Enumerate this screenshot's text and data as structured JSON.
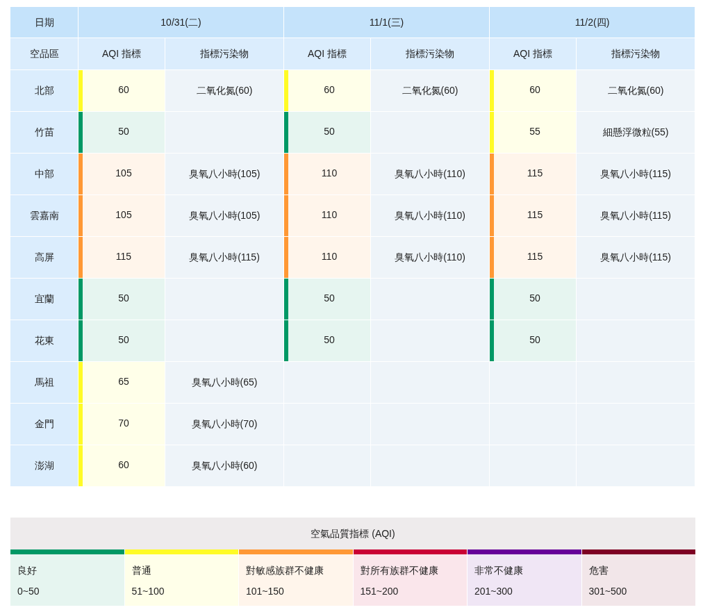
{
  "table": {
    "date_heading": "日期",
    "region_heading": "空品區",
    "dates": [
      {
        "date": "10/31(二)",
        "aqi_heading": "AQI 指標",
        "pollutant_heading": "指標污染物"
      },
      {
        "date": "11/1(三)",
        "aqi_heading": "AQI 指標",
        "pollutant_heading": "指標污染物"
      },
      {
        "date": "11/2(四)",
        "aqi_heading": "AQI 指標",
        "pollutant_heading": "指標污染物"
      }
    ],
    "rows": [
      {
        "region": "北部",
        "days": [
          {
            "aqi": "60",
            "pollutant": "二氧化氮(60)",
            "color": "#fffb26"
          },
          {
            "aqi": "60",
            "pollutant": "二氧化氮(60)",
            "color": "#fffb26"
          },
          {
            "aqi": "60",
            "pollutant": "二氧化氮(60)",
            "color": "#fffb26"
          }
        ]
      },
      {
        "region": "竹苗",
        "days": [
          {
            "aqi": "50",
            "color": "#009865"
          },
          {
            "aqi": "50",
            "color": "#009865"
          },
          {
            "aqi": "55",
            "pollutant": "細懸浮微粒(55)",
            "color": "#fffb26"
          }
        ]
      },
      {
        "region": "中部",
        "days": [
          {
            "aqi": "105",
            "pollutant": "臭氧八小時(105)",
            "color": "#ff9835"
          },
          {
            "aqi": "110",
            "pollutant": "臭氧八小時(110)",
            "color": "#ff9835"
          },
          {
            "aqi": "115",
            "pollutant": "臭氧八小時(115)",
            "color": "#ff9835"
          }
        ]
      },
      {
        "region": "雲嘉南",
        "days": [
          {
            "aqi": "105",
            "pollutant": "臭氧八小時(105)",
            "color": "#ff9835"
          },
          {
            "aqi": "110",
            "pollutant": "臭氧八小時(110)",
            "color": "#ff9835"
          },
          {
            "aqi": "115",
            "pollutant": "臭氧八小時(115)",
            "color": "#ff9835"
          }
        ]
      },
      {
        "region": "高屏",
        "days": [
          {
            "aqi": "115",
            "pollutant": "臭氧八小時(115)",
            "color": "#ff9835"
          },
          {
            "aqi": "110",
            "pollutant": "臭氧八小時(110)",
            "color": "#ff9835"
          },
          {
            "aqi": "115",
            "pollutant": "臭氧八小時(115)",
            "color": "#ff9835"
          }
        ]
      },
      {
        "region": "宜蘭",
        "days": [
          {
            "aqi": "50",
            "color": "#009865"
          },
          {
            "aqi": "50",
            "color": "#009865"
          },
          {
            "aqi": "50",
            "color": "#009865"
          }
        ]
      },
      {
        "region": "花東",
        "days": [
          {
            "aqi": "50",
            "color": "#009865"
          },
          {
            "aqi": "50",
            "color": "#009865"
          },
          {
            "aqi": "50",
            "color": "#009865"
          }
        ]
      },
      {
        "region": "馬祖",
        "days": [
          {
            "aqi": "65",
            "pollutant": "臭氧八小時(65)",
            "color": "#fffb26"
          }
        ]
      },
      {
        "region": "金門",
        "days": [
          {
            "aqi": "70",
            "pollutant": "臭氧八小時(70)",
            "color": "#fffb26"
          }
        ]
      },
      {
        "region": "澎湖",
        "days": [
          {
            "aqi": "60",
            "pollutant": "臭氧八小時(60)",
            "color": "#fffb26"
          }
        ]
      }
    ]
  },
  "legend": {
    "title": "空氣品質指標 (AQI)",
    "levels": [
      {
        "label": "良好",
        "range": "0~50",
        "color": "#009865"
      },
      {
        "label": "普通",
        "range": "51~100",
        "color": "#fffb26"
      },
      {
        "label": "對敏感族群不健康",
        "range": "101~150",
        "color": "#ff9835"
      },
      {
        "label": "對所有族群不健康",
        "range": "151~200",
        "color": "#ca0034"
      },
      {
        "label": "非常不健康",
        "range": "201~300",
        "color": "#670099"
      },
      {
        "label": "危害",
        "range": "301~500",
        "color": "#7e0023"
      }
    ]
  }
}
